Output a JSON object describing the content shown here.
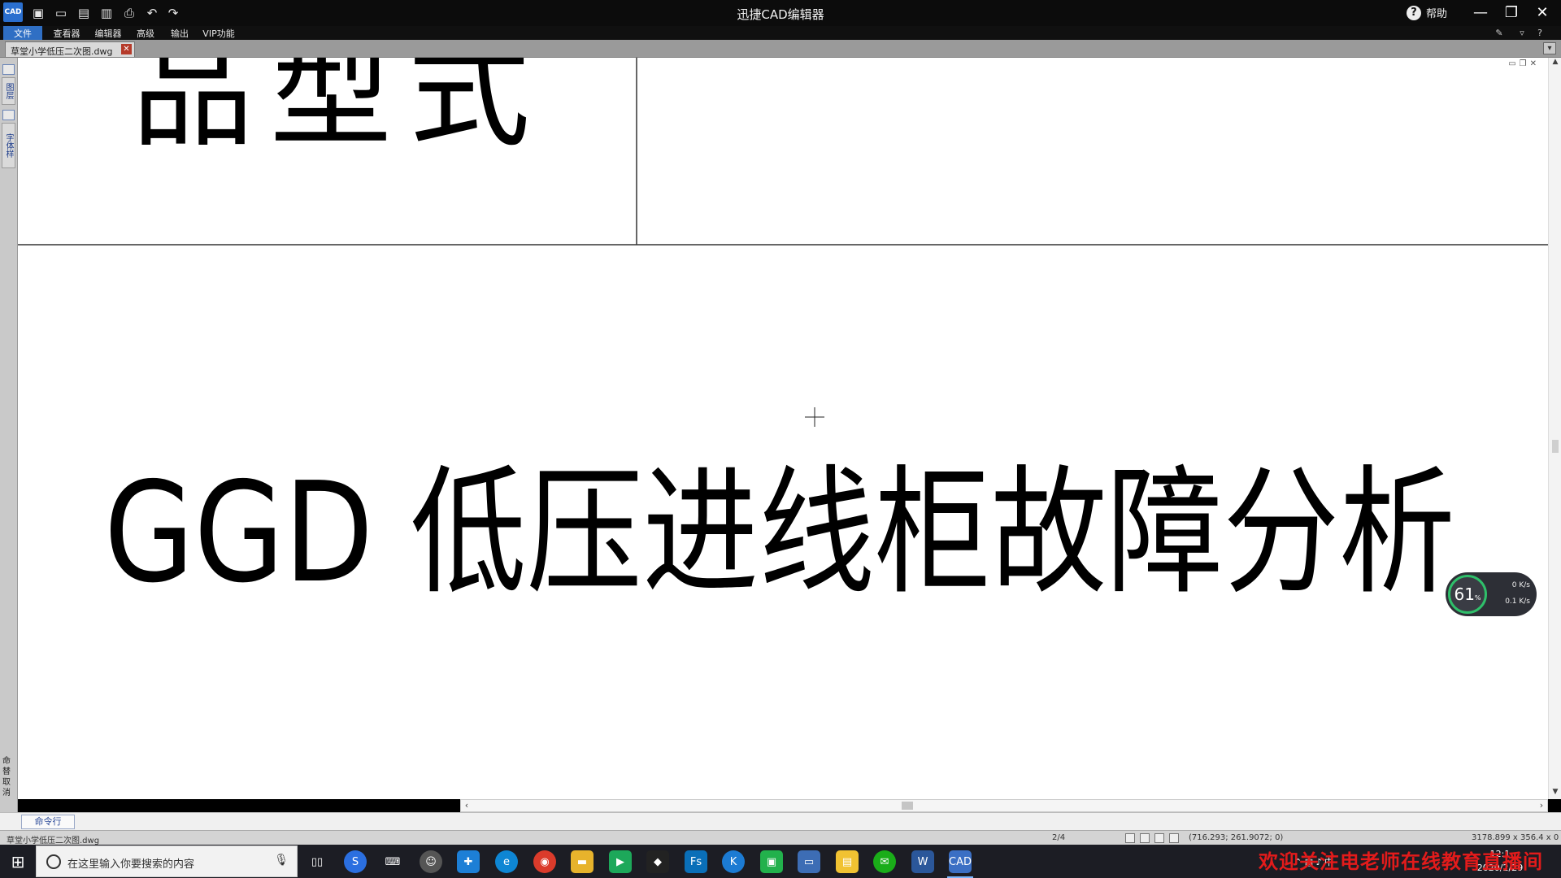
{
  "window": {
    "title": "迅捷CAD编辑器",
    "logo": "CAD",
    "help_label": "帮助"
  },
  "quick_toolbar": [
    "new-icon",
    "open-icon",
    "save-icon",
    "save-as-icon",
    "print-icon",
    "undo-icon",
    "redo-icon"
  ],
  "menus": [
    "文件",
    "查看器",
    "编辑器",
    "高级",
    "输出",
    "VIP功能"
  ],
  "document_tab": {
    "label": "草堂小学低压二次图.dwg"
  },
  "left_dock": {
    "buttons": [
      "图层",
      "字体样"
    ],
    "cmd_label": "命替取消"
  },
  "canvas": {
    "text_top": "品型式",
    "text_main": "GGD 低压进线柜故障分析",
    "text_color": "#000000",
    "background": "#ffffff"
  },
  "command_line": {
    "tab_label": "命令行"
  },
  "status_bar": {
    "file_name": "草堂小学低压二次图.dwg",
    "page": "2/4",
    "coords": "(716.293; 261.9072; 0)",
    "extent": "3178.899 x 356.4 x 0"
  },
  "net_meter": {
    "percent": "61",
    "percent_unit": "%",
    "upload": "0 K/s",
    "download": "0.1 K/s"
  },
  "taskbar": {
    "search_placeholder": "在这里输入你要搜索的内容",
    "apps": [
      "task-view-icon",
      "sogou-icon",
      "keyboard-icon",
      "face-icon",
      "app-store-icon",
      "browser-icon",
      "chrome-icon",
      "explorer-icon",
      "player-icon",
      "qq-icon",
      "fs-icon",
      "k-icon",
      "video-icon",
      "monitor-icon",
      "notes-icon",
      "wechat-icon",
      "word-icon",
      "cad-icon"
    ],
    "clock_time": "12:1",
    "clock_date": "2020/2/29",
    "overlay_text": "欢迎关注电老师在线教育直播间"
  }
}
